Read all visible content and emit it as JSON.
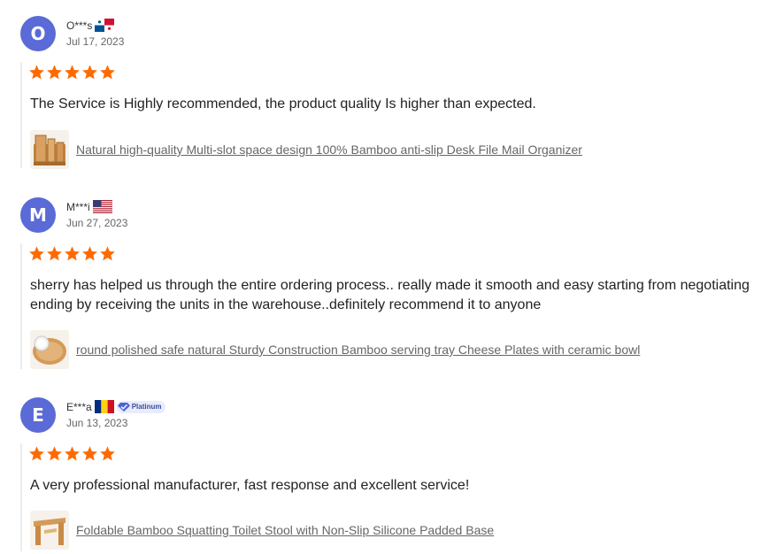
{
  "reviews": [
    {
      "initial": "O",
      "name": "O***s",
      "country_flag": "panama-flag",
      "badge": "",
      "date": "Jul 17, 2023",
      "rating": 5,
      "text": "The Service is Highly recommended, the product quality Is higher than expected.",
      "product_thumb": "desk-organizer-thumbnail",
      "product": "Natural high-quality Multi-slot space design 100% Bamboo anti-slip Desk File Mail Organizer"
    },
    {
      "initial": "M",
      "name": "M***i",
      "country_flag": "usa-flag",
      "badge": "",
      "date": "Jun 27, 2023",
      "rating": 5,
      "text": "sherry has helped us through the entire ordering process.. really made it smooth and easy starting from negotiating ending by receiving the units in the warehouse..definitely recommend it to anyone",
      "product_thumb": "serving-tray-thumbnail",
      "product": "round polished safe natural Sturdy Construction Bamboo serving tray Cheese Plates with ceramic bowl"
    },
    {
      "initial": "E",
      "name": "E***a",
      "country_flag": "romania-flag",
      "badge": "Platinum",
      "date": "Jun 13, 2023",
      "rating": 5,
      "text": "A very professional manufacturer, fast response and excellent service!",
      "product_thumb": "toilet-stool-thumbnail",
      "product": "Foldable Bamboo Squatting Toilet Stool with Non-Slip Silicone Padded Base"
    }
  ],
  "colors": {
    "avatar": "#5a6ad6",
    "star": "#ff6a00",
    "link": "#666666"
  }
}
